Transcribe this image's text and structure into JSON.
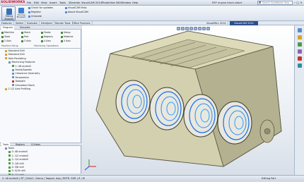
{
  "app": {
    "logo": "SOLIDWORKS",
    "menu": [
      "File",
      "Edit",
      "View",
      "Insert",
      "Tools",
      "3Dcenter",
      "VisualCAM 2014",
      "PhotoView 360",
      "Window",
      "Help"
    ],
    "doc_title": "REF engine block.sldprt",
    "search_placeholder": "Search SolidWorks Help",
    "win_controls": "– □ ×"
  },
  "ribbon": {
    "main_button": "Milling Browser",
    "big_buttons": [
      {
        "label": "Turning Browser",
        "color": "#3d7fcf"
      },
      {
        "label": "Help",
        "color": "#d39a26"
      }
    ],
    "items": [
      "Check for updates",
      "Register",
      "Unlocate"
    ],
    "items2": [
      "VisualCAM Help",
      "About VisualCAM"
    ]
  },
  "tabs": [
    "Features",
    "Sketch",
    "Evaluate",
    "DimXpert",
    "Render Tools",
    "Office Products"
  ],
  "tabs_right": [
    "VisualMILL 2014",
    "VisualCAM 2014"
  ],
  "left_panel": {
    "tabs": [
      "Program",
      "Simulate"
    ],
    "tool_rows": [
      [
        "Machine",
        "Stock",
        "Feeds",
        "Setup"
      ],
      [
        "Tools",
        "Part",
        "Regions",
        "Material"
      ],
      [
        "2 Axis",
        "3 Axis",
        "4 Axis",
        "5 Axis"
      ]
    ],
    "section_labels": [
      "Machine Setup",
      "Machining Operations"
    ],
    "tree": [
      {
        "label": "Standard Drill",
        "indent": 1,
        "c": "y"
      },
      {
        "label": "Standard Drill",
        "indent": 1,
        "c": "y"
      },
      {
        "label": "Hole Pocketing",
        "indent": 1,
        "c": "y"
      },
      {
        "label": "Machining Features",
        "indent": 2,
        "c": "b"
      },
      {
        "label": "1: 48 endmill",
        "indent": 3,
        "c": "g"
      },
      {
        "label": "Feeds/Speeds",
        "indent": 3,
        "c": "b"
      },
      {
        "label": "Clearance Geometry",
        "indent": 3,
        "c": "b"
      },
      {
        "label": "Parameters",
        "indent": 3,
        "c": "b"
      },
      {
        "label": "Toolpath",
        "indent": 3,
        "c": "r"
      },
      {
        "label": "Simulated Stock",
        "indent": 3,
        "c": "b"
      },
      {
        "label": "2 1/2 Axis Profiling",
        "indent": 1,
        "c": "y"
      }
    ],
    "lower_tabs": [
      "Tools",
      "Regions",
      "G-Views"
    ],
    "lower_tree": [
      {
        "label": "Tools",
        "indent": 1,
        "c": "b"
      },
      {
        "label": "0: 48 endmill",
        "indent": 2,
        "c": "g"
      },
      {
        "label": "1: 1/2 endmill",
        "indent": 2,
        "c": "g"
      },
      {
        "label": "2: 1/4 endmill",
        "indent": 2,
        "c": "g"
      },
      {
        "label": "3: 1/8 drill",
        "indent": 2,
        "c": "g"
      },
      {
        "label": "4: 3/8 drill",
        "indent": 2,
        "c": "g"
      },
      {
        "label": "5: 5/16 drill",
        "indent": 2,
        "c": "g"
      },
      {
        "label": "6: 1/2 drill",
        "indent": 2,
        "c": "g"
      },
      {
        "label": "7: 3/4 endmill",
        "indent": 2,
        "c": "g"
      }
    ]
  },
  "status": {
    "left": "2: 48 endmill | RT | Dist/1, Clamp | Tapped, deg | REFR, SHR | R | M",
    "right": "Editing Part"
  },
  "icons": {
    "search": "search-icon",
    "triad": "axis-triad-icon"
  }
}
